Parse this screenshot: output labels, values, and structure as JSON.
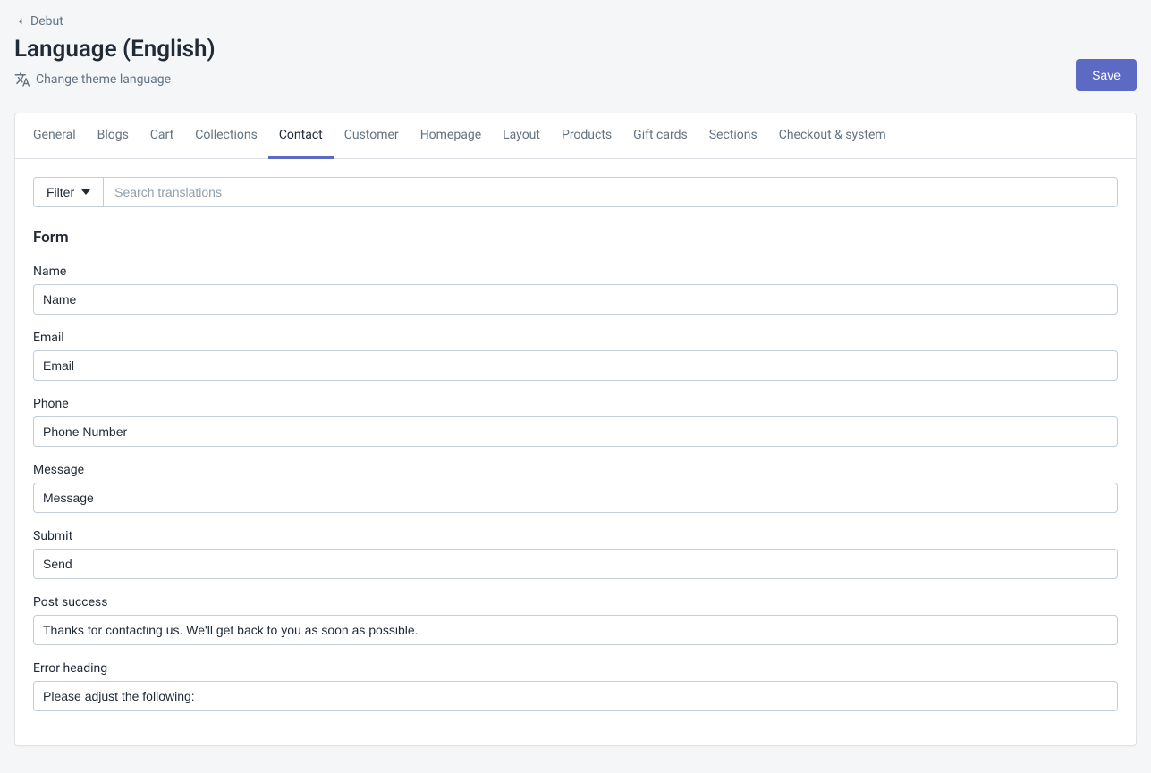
{
  "breadcrumb": {
    "label": "Debut"
  },
  "page_title": "Language (English)",
  "change_language_label": "Change theme language",
  "save_label": "Save",
  "tabs": [
    {
      "label": "General",
      "active": false
    },
    {
      "label": "Blogs",
      "active": false
    },
    {
      "label": "Cart",
      "active": false
    },
    {
      "label": "Collections",
      "active": false
    },
    {
      "label": "Contact",
      "active": true
    },
    {
      "label": "Customer",
      "active": false
    },
    {
      "label": "Homepage",
      "active": false
    },
    {
      "label": "Layout",
      "active": false
    },
    {
      "label": "Products",
      "active": false
    },
    {
      "label": "Gift cards",
      "active": false
    },
    {
      "label": "Sections",
      "active": false
    },
    {
      "label": "Checkout & system",
      "active": false
    }
  ],
  "filter": {
    "label": "Filter",
    "search_placeholder": "Search translations"
  },
  "section": {
    "heading": "Form",
    "fields": [
      {
        "label": "Name",
        "value": "Name"
      },
      {
        "label": "Email",
        "value": "Email"
      },
      {
        "label": "Phone",
        "value": "Phone Number"
      },
      {
        "label": "Message",
        "value": "Message"
      },
      {
        "label": "Submit",
        "value": "Send"
      },
      {
        "label": "Post success",
        "value": "Thanks for contacting us. We'll get back to you as soon as possible."
      },
      {
        "label": "Error heading",
        "value": "Please adjust the following:"
      }
    ]
  }
}
